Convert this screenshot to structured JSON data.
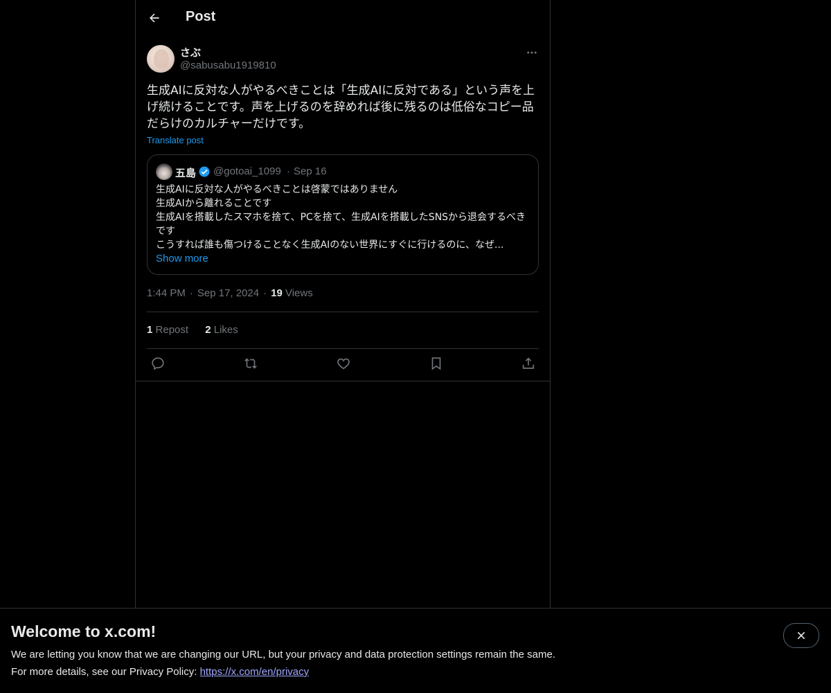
{
  "header": {
    "title": "Post"
  },
  "post": {
    "author_name": "さぶ",
    "author_handle": "@sabusabu1919810",
    "text": "生成AIに反対な人がやるべきことは「生成AIに反対である」という声を上げ続けることです。声を上げるのを辞めれば後に残るのは低俗なコピー品だらけのカルチャーだけです。",
    "translate_label": "Translate post",
    "time": "1:44 PM",
    "date": "Sep 17, 2024",
    "views_count": "19",
    "views_label": "Views",
    "separator": "·",
    "repost_count": "1",
    "repost_label": "Repost",
    "likes_count": "2",
    "likes_label": "Likes"
  },
  "quote": {
    "author_name": "五島",
    "author_handle": "@gotoai_1099",
    "separator": "·",
    "date": "Sep 16",
    "lines": [
      "生成AIに反対な人がやるべきことは啓蒙ではありません",
      "生成AIから離れることです",
      "生成AIを搭載したスマホを捨て、PCを捨て、生成AIを搭載したSNSから退会するべきです",
      "こうすれば誰も傷つけることなく生成AIのない世界にすぐに行けるのに、なぜ..."
    ],
    "show_more": "Show more"
  },
  "actions": [
    "reply-icon",
    "repost-icon",
    "like-icon",
    "bookmark-icon",
    "share-icon"
  ],
  "banner": {
    "title": "Welcome to x.com!",
    "line1": "We are letting you know that we are changing our URL, but your privacy and data protection settings remain the same.",
    "line2_prefix": "For more details, see our Privacy Policy: ",
    "link": "https://x.com/en/privacy"
  },
  "colors": {
    "background": "#000000",
    "text": "#e7e9ea",
    "muted": "#71767b",
    "accent": "#1d9bf0",
    "border": "#2f3336",
    "link": "#a0a6ff"
  }
}
